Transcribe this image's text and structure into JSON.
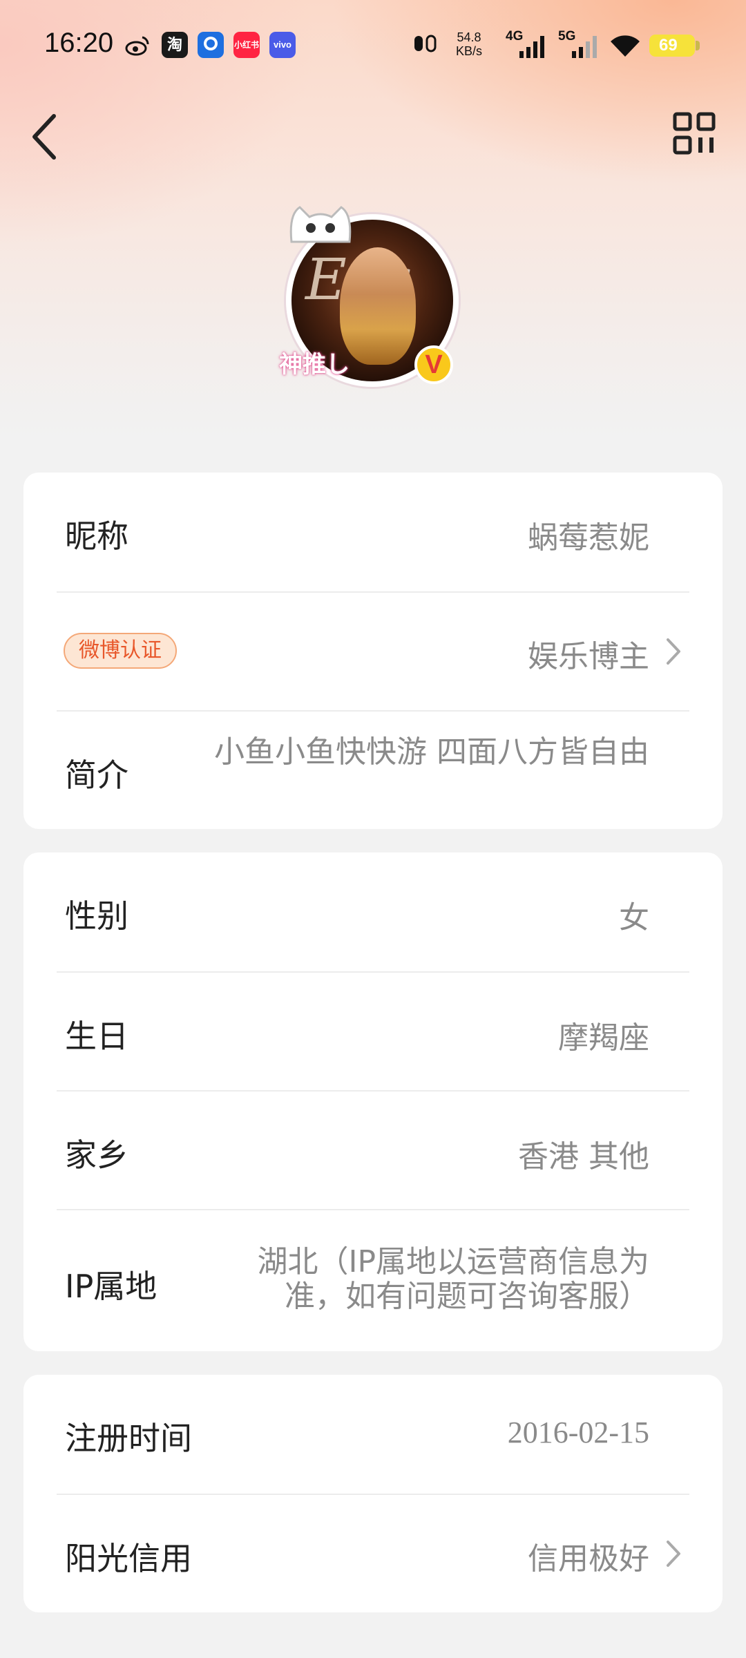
{
  "status_bar": {
    "time": "16:20",
    "apps": [
      {
        "name": "weibo-app-icon",
        "label": ""
      },
      {
        "name": "taobao-app-icon",
        "label": "淘"
      },
      {
        "name": "blue-app-icon",
        "label": ""
      },
      {
        "name": "xiaohongshu-app-icon",
        "label": "小红书"
      },
      {
        "name": "vivo-app-icon",
        "label": "vivo"
      }
    ],
    "speed_value": "54.8",
    "speed_unit": "KB/s",
    "net1": "4G",
    "net2": "5G",
    "battery": "69"
  },
  "profile": {
    "avatar_text": "Eer",
    "avatar_caption": "神推し",
    "verify_mark": "V"
  },
  "basic_info": {
    "nickname_label": "昵称",
    "nickname_value": "蜗莓惹妮",
    "verify_badge": "微博认证",
    "verify_value": "娱乐博主",
    "bio_label": "简介",
    "bio_value": "小鱼小鱼快快游 四面八方皆自由"
  },
  "personal_info": {
    "gender_label": "性别",
    "gender_value": "女",
    "birthday_label": "生日",
    "birthday_value": "摩羯座",
    "hometown_label": "家乡",
    "hometown_value": "香港 其他",
    "ip_label": "IP属地",
    "ip_value": "湖北（IP属地以运营商信息为准，如有问题可咨询客服）"
  },
  "account_info": {
    "register_label": "注册时间",
    "register_value": "2016-02-15",
    "credit_label": "阳光信用",
    "credit_value": "信用极好"
  }
}
